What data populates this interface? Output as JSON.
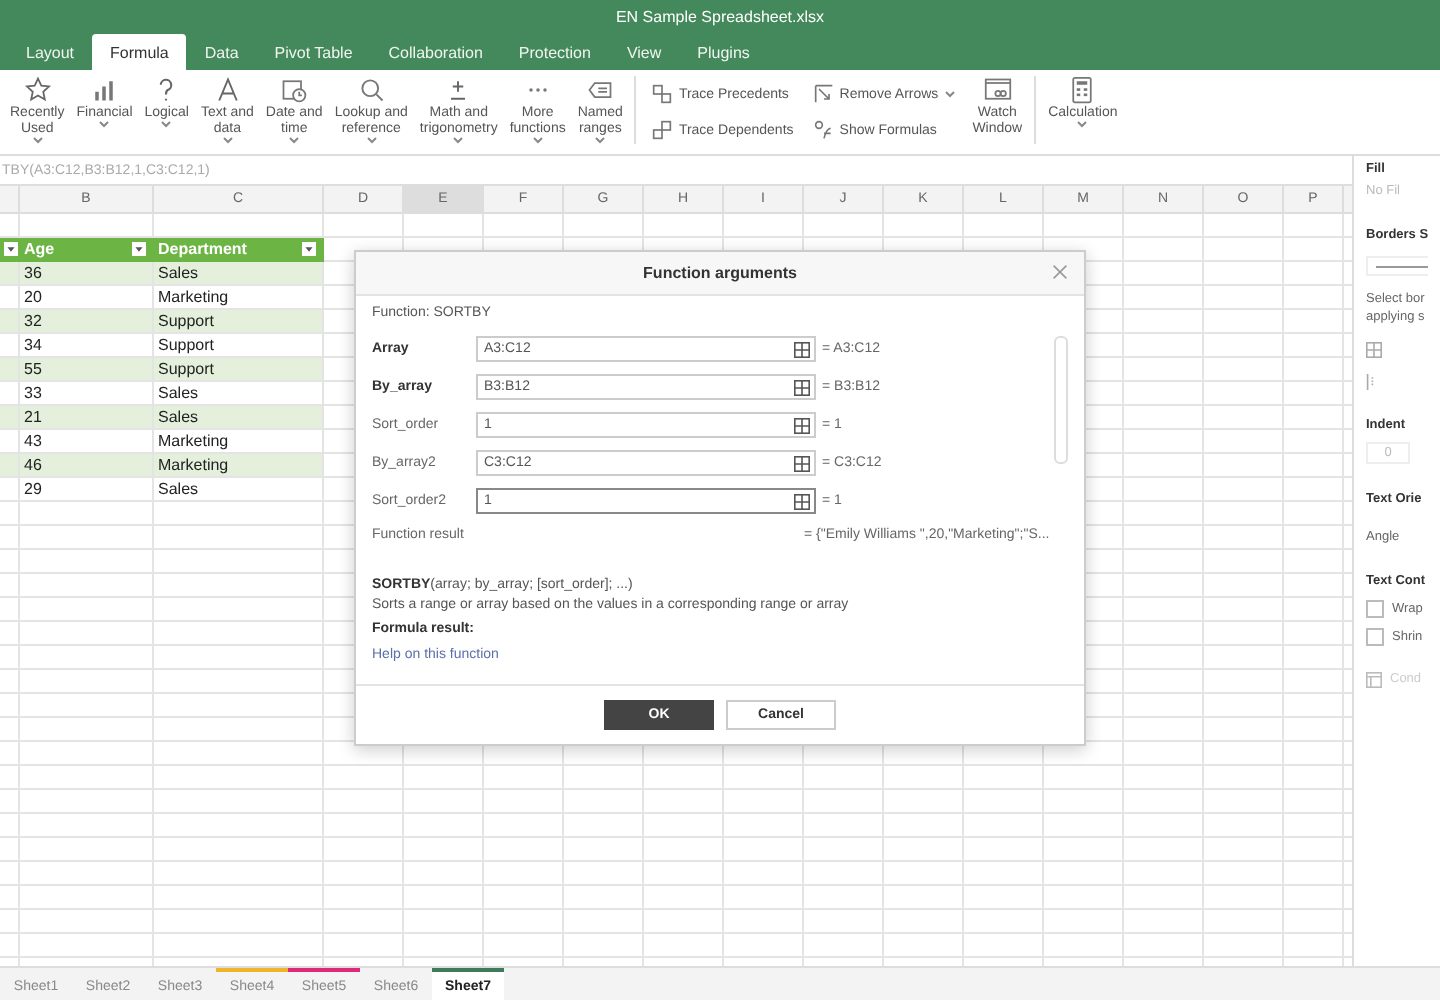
{
  "window": {
    "title": "EN Sample Spreadsheet.xlsx"
  },
  "menu_tabs": [
    {
      "label": "Layout",
      "selected": false
    },
    {
      "label": "Formula",
      "selected": true
    },
    {
      "label": "Data",
      "selected": false
    },
    {
      "label": "Pivot Table",
      "selected": false
    },
    {
      "label": "Collaboration",
      "selected": false
    },
    {
      "label": "Protection",
      "selected": false
    },
    {
      "label": "View",
      "selected": false
    },
    {
      "label": "Plugins",
      "selected": false
    }
  ],
  "ribbon": {
    "functions": [
      {
        "label": "Recently\nUsed"
      },
      {
        "label": "Financial"
      },
      {
        "label": "Logical"
      },
      {
        "label": "Text and\ndata"
      },
      {
        "label": "Date and\ntime"
      },
      {
        "label": "Lookup and\nreference"
      },
      {
        "label": "Math and\ntrigonometry"
      },
      {
        "label": "More\nfunctions"
      },
      {
        "label": "Named\nranges"
      }
    ],
    "auditing": [
      {
        "label": "Trace Precedents",
        "dropdown": false
      },
      {
        "label": "Trace Dependents",
        "dropdown": false
      },
      {
        "label": "Remove Arrows",
        "dropdown": true
      },
      {
        "label": "Show Formulas",
        "dropdown": false
      }
    ],
    "watch": {
      "label": "Watch\nWindow"
    },
    "calculation": {
      "label": "Calculation"
    }
  },
  "formula_bar": {
    "text": "TBY(A3:C12,B3:B12,1,C3:C12,1)"
  },
  "sheet": {
    "columns": [
      {
        "label": "B",
        "selected": false
      },
      {
        "label": "C",
        "selected": false
      },
      {
        "label": "D",
        "selected": false
      },
      {
        "label": "E",
        "selected": true
      },
      {
        "label": "F",
        "selected": false
      },
      {
        "label": "G",
        "selected": false
      },
      {
        "label": "H",
        "selected": false
      },
      {
        "label": "I",
        "selected": false
      },
      {
        "label": "J",
        "selected": false
      },
      {
        "label": "K",
        "selected": false
      },
      {
        "label": "L",
        "selected": false
      },
      {
        "label": "M",
        "selected": false
      },
      {
        "label": "N",
        "selected": false
      },
      {
        "label": "O",
        "selected": false
      },
      {
        "label": "P",
        "selected": false
      }
    ],
    "table_header": [
      "Age",
      "Department"
    ],
    "rows": [
      {
        "age": "36",
        "department": "Sales"
      },
      {
        "age": "20",
        "department": "Marketing"
      },
      {
        "age": "32",
        "department": "Support"
      },
      {
        "age": "34",
        "department": "Support"
      },
      {
        "age": "55",
        "department": "Support"
      },
      {
        "age": "33",
        "department": "Sales"
      },
      {
        "age": "21",
        "department": "Sales"
      },
      {
        "age": "43",
        "department": "Marketing"
      },
      {
        "age": "46",
        "department": "Marketing"
      },
      {
        "age": "29",
        "department": "Sales"
      }
    ]
  },
  "dialog": {
    "title": "Function arguments",
    "function": "Function: SORTBY",
    "arguments": [
      {
        "label": "Array",
        "required": true,
        "value": "A3:C12",
        "result": "= A3:C12",
        "focused": false
      },
      {
        "label": "By_array",
        "required": true,
        "value": "B3:B12",
        "result": "= B3:B12",
        "focused": false
      },
      {
        "label": "Sort_order",
        "required": false,
        "value": "1",
        "result": "= 1",
        "focused": false
      },
      {
        "label": "By_array2",
        "required": false,
        "value": "C3:C12",
        "result": "= C3:C12",
        "focused": false
      },
      {
        "label": "Sort_order2",
        "required": false,
        "value": "1",
        "result": "= 1",
        "focused": true
      }
    ],
    "function_result_label": "Function result",
    "function_result_value": "= {\"Emily Williams \",20,\"Marketing\";\"S...",
    "syntax": "**SORTBY**(array; by_array; [sort_order]; ...)",
    "description": "Sorts a range or array based on the values in a corresponding range or array",
    "formula_result_label": "Formula result:",
    "help_link": "Help on this function",
    "buttons": [
      {
        "label": "OK",
        "primary": true
      },
      {
        "label": "Cancel",
        "primary": false
      }
    ]
  },
  "right_panel": {
    "fill_title": "Fill",
    "fill_value": "No Fil",
    "borders_title": "Borders S",
    "borders_hint": [
      "Select bor",
      "applying s"
    ],
    "indent_title": "Indent",
    "indent_value": "0",
    "orientation_title": "Text Orie",
    "angle_label": "Angle",
    "control_title": "Text Cont",
    "checkboxes": [
      {
        "label": "Wrap",
        "checked": false
      },
      {
        "label": "Shrin",
        "checked": false
      }
    ],
    "conditional": "Cond"
  },
  "sheet_tabs": [
    {
      "label": "Sheet1",
      "selected": false
    },
    {
      "label": "Sheet2",
      "selected": false
    },
    {
      "label": "Sheet3",
      "selected": false
    },
    {
      "label": "Sheet4",
      "selected": false,
      "color": "#f0b429"
    },
    {
      "label": "Sheet5",
      "selected": false,
      "color": "#e0287a"
    },
    {
      "label": "Sheet6",
      "selected": false
    },
    {
      "label": "Sheet7",
      "selected": true,
      "color": "#3f7a5c"
    }
  ]
}
